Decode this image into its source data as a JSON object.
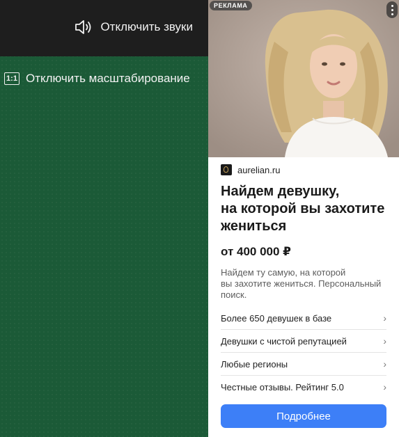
{
  "player": {
    "mute_label": "Отключить звуки",
    "mute_icon": "speaker-icon",
    "zoom_icon_text": "1:1",
    "zoom_label": "Отключить масштабирование",
    "colors": {
      "top_bar": "#1e1e1e",
      "board": "#1b5a37"
    }
  },
  "ad": {
    "badge": "РЕКЛАМА",
    "menu_icon": "kebab-menu-icon",
    "source": "aurelian.ru",
    "title": "Найдем девушку,\nна которой вы захотите\nжениться",
    "price": "от 400 000 ₽",
    "description": "Найдем ту самую, на которой\nвы захотите жениться. Персональный\nпоиск.",
    "features": [
      "Более 650 девушек в базе",
      "Девушки с чистой репутацией",
      "Любые регионы",
      "Честные отзывы. Рейтинг 5.0"
    ],
    "chevron": "›",
    "cta": "Подробнее",
    "colors": {
      "cta": "#3d7ff7"
    }
  }
}
